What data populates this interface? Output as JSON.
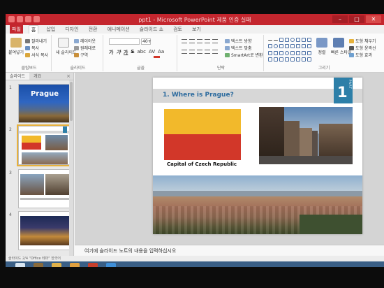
{
  "window": {
    "title": "ppt1 - Microsoft PowerPoint 제품 인증 실패"
  },
  "tabs": [
    {
      "label": "파일"
    },
    {
      "label": "홈"
    },
    {
      "label": "삽입"
    },
    {
      "label": "디자인"
    },
    {
      "label": "전환"
    },
    {
      "label": "애니메이션"
    },
    {
      "label": "슬라이드 쇼"
    },
    {
      "label": "검토"
    },
    {
      "label": "보기"
    }
  ],
  "ribbon": {
    "clipboard": {
      "paste_label": "붙여넣기",
      "cut_label": "잘라내기",
      "copy_label": "복사",
      "format_painter_label": "서식 복사",
      "group_label": "클립보드"
    },
    "slides": {
      "new_slide_label": "새 슬라이드",
      "layout_label": "레이아웃",
      "reset_label": "원래대로",
      "section_label": "구역",
      "group_label": "슬라이드"
    },
    "font": {
      "size_value": "40+",
      "group_label": "글꼴",
      "bold": "가",
      "italic": "가",
      "underline": "가",
      "strike": "S",
      "shadow": "abc",
      "spacing": "AV",
      "case": "Aa"
    },
    "paragraph": {
      "text_direction_label": "텍스트 방향",
      "align_text_label": "텍스트 맞춤",
      "smartart_label": "SmartArt로 변환",
      "group_label": "단락"
    },
    "drawing": {
      "arrange_label": "정렬",
      "quick_styles_label": "빠른 스타일",
      "fill_label": "도형 채우기",
      "outline_label": "도형 윤곽선",
      "effects_label": "도형 효과",
      "group_label": "그리기"
    }
  },
  "pane": {
    "tab_slides": "슬라이드",
    "tab_outline": "개요",
    "close": "×",
    "thumbs": [
      {
        "num": "1",
        "title": "Prague"
      },
      {
        "num": "2"
      },
      {
        "num": "3"
      },
      {
        "num": "4"
      }
    ]
  },
  "slide": {
    "title": "1. Where is Prague?",
    "part_word": "PART",
    "part_number": "1",
    "caption": "Capital of Czech Republic"
  },
  "notes": {
    "placeholder": "여기에 슬라이드 노트의 내용을 입력하십시오"
  },
  "status": {
    "text": "슬라이드 2/4   \"Office 테마\"   한국어"
  },
  "colors": {
    "title_bar": "#c4262e",
    "flag_yellow": "#f2b92b",
    "flag_red": "#d23729",
    "slide_title": "#2d6b9e",
    "part_badge": "#2d7fa8",
    "taskbar": "#3a5f86"
  }
}
